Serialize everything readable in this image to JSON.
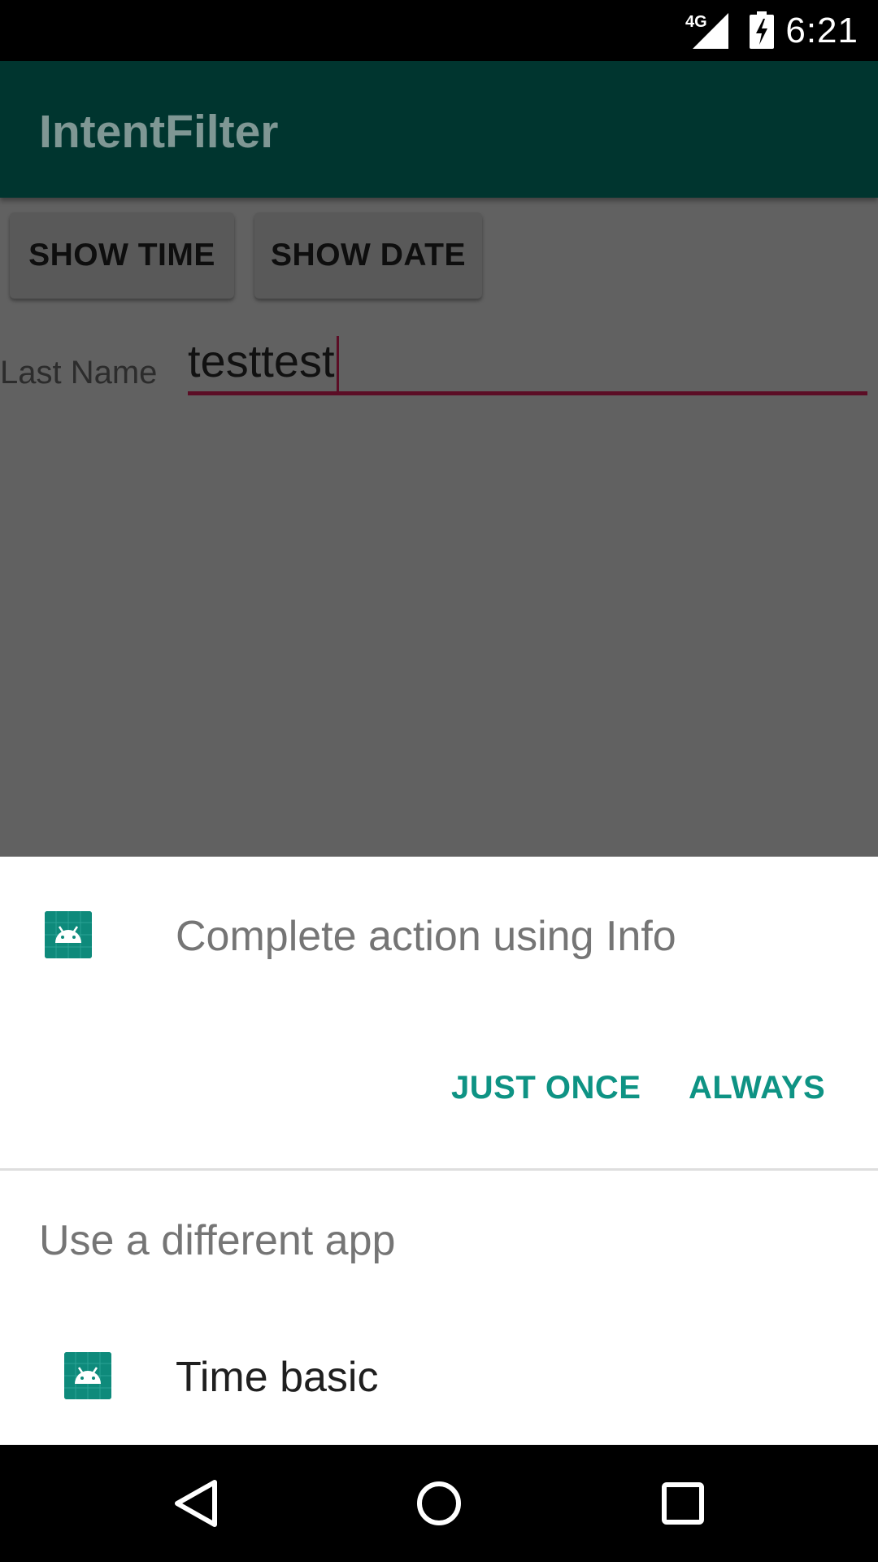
{
  "status_bar": {
    "network": "4G",
    "time": "6:21",
    "icons": [
      "signal-icon",
      "battery-charging-icon"
    ]
  },
  "app_bar": {
    "title": "IntentFilter"
  },
  "content": {
    "show_time_label": "SHOW TIME",
    "show_date_label": "SHOW DATE",
    "last_name_label": "Last Name",
    "last_name_value": "testtest"
  },
  "sheet": {
    "heading": "Complete action using Info",
    "just_once_label": "JUST ONCE",
    "always_label": "ALWAYS",
    "different_app_label": "Use a different app",
    "alt_app_name": "Time basic",
    "icon": "android-app-icon"
  },
  "nav_bar": {
    "icons": [
      "back-icon",
      "home-icon",
      "recents-icon"
    ]
  },
  "colors": {
    "accent": "#0e9384",
    "app_bar": "#00352f",
    "input_underline": "#5b0d25"
  }
}
